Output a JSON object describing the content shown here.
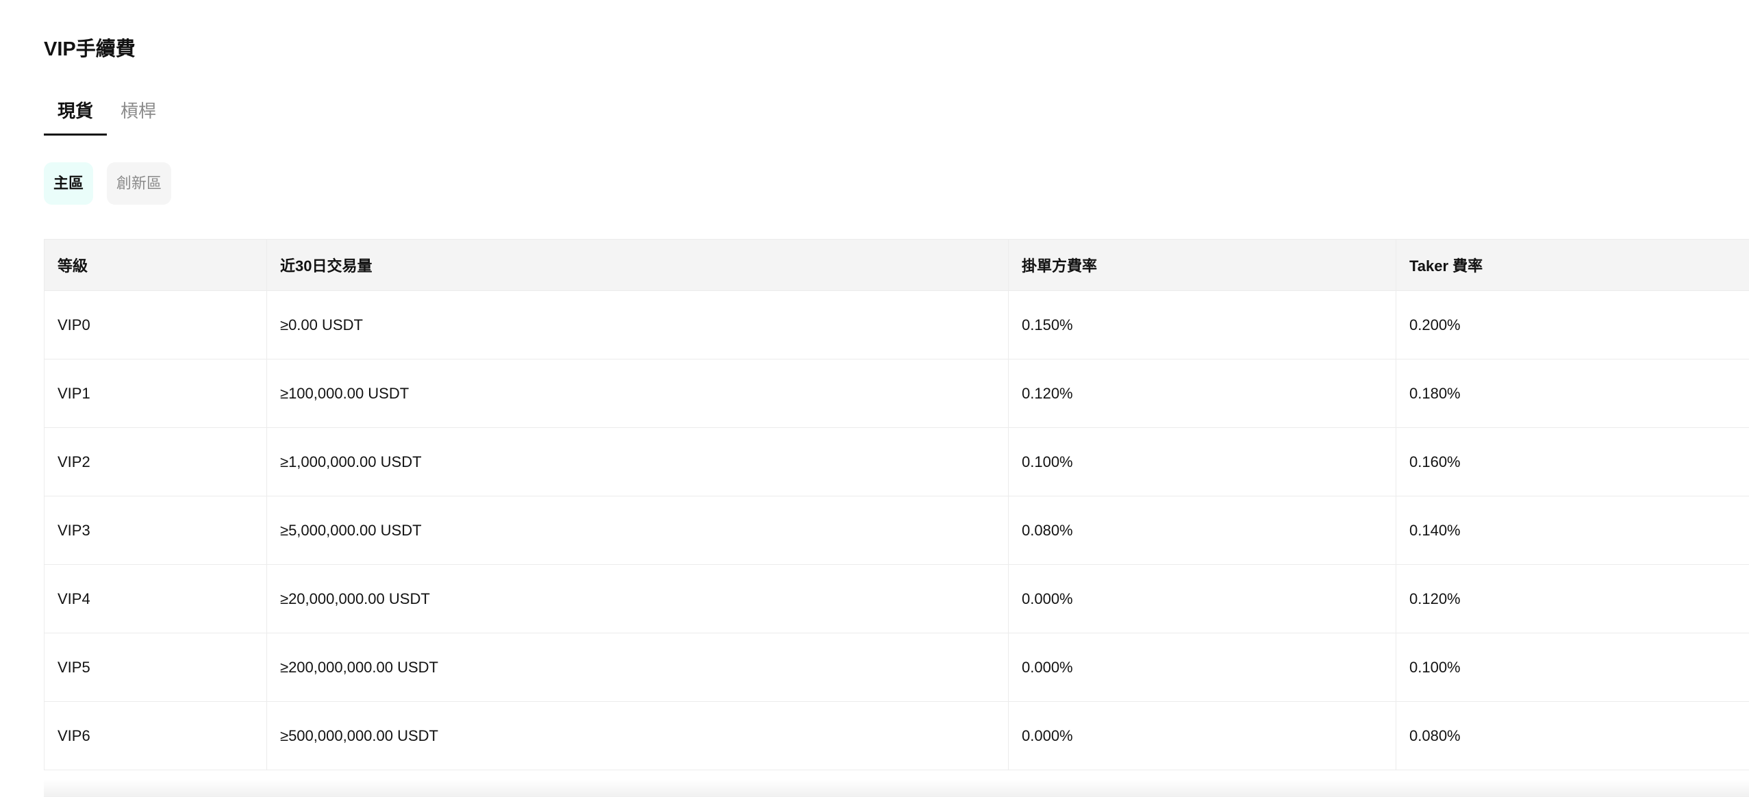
{
  "page": {
    "title": "VIP手續費"
  },
  "tabs": [
    {
      "label": "現貨",
      "active": true
    },
    {
      "label": "槓桿",
      "active": false
    }
  ],
  "segments": [
    {
      "label": "主區",
      "active": true
    },
    {
      "label": "創新區",
      "active": false
    }
  ],
  "table": {
    "headers": [
      "等級",
      "近30日交易量",
      "掛單方費率",
      "Taker 費率"
    ],
    "rows": [
      [
        "VIP0",
        "≥0.00 USDT",
        "0.150%",
        "0.200%"
      ],
      [
        "VIP1",
        "≥100,000.00 USDT",
        "0.120%",
        "0.180%"
      ],
      [
        "VIP2",
        "≥1,000,000.00 USDT",
        "0.100%",
        "0.160%"
      ],
      [
        "VIP3",
        "≥5,000,000.00 USDT",
        "0.080%",
        "0.140%"
      ],
      [
        "VIP4",
        "≥20,000,000.00 USDT",
        "0.000%",
        "0.120%"
      ],
      [
        "VIP5",
        "≥200,000,000.00 USDT",
        "0.000%",
        "0.100%"
      ],
      [
        "VIP6",
        "≥500,000,000.00 USDT",
        "0.000%",
        "0.080%"
      ]
    ]
  },
  "colors": {
    "active_segment_bg": "#eafdfa",
    "header_bg": "#f4f4f4",
    "text_primary": "#121212",
    "text_muted": "#8a8a8a"
  }
}
